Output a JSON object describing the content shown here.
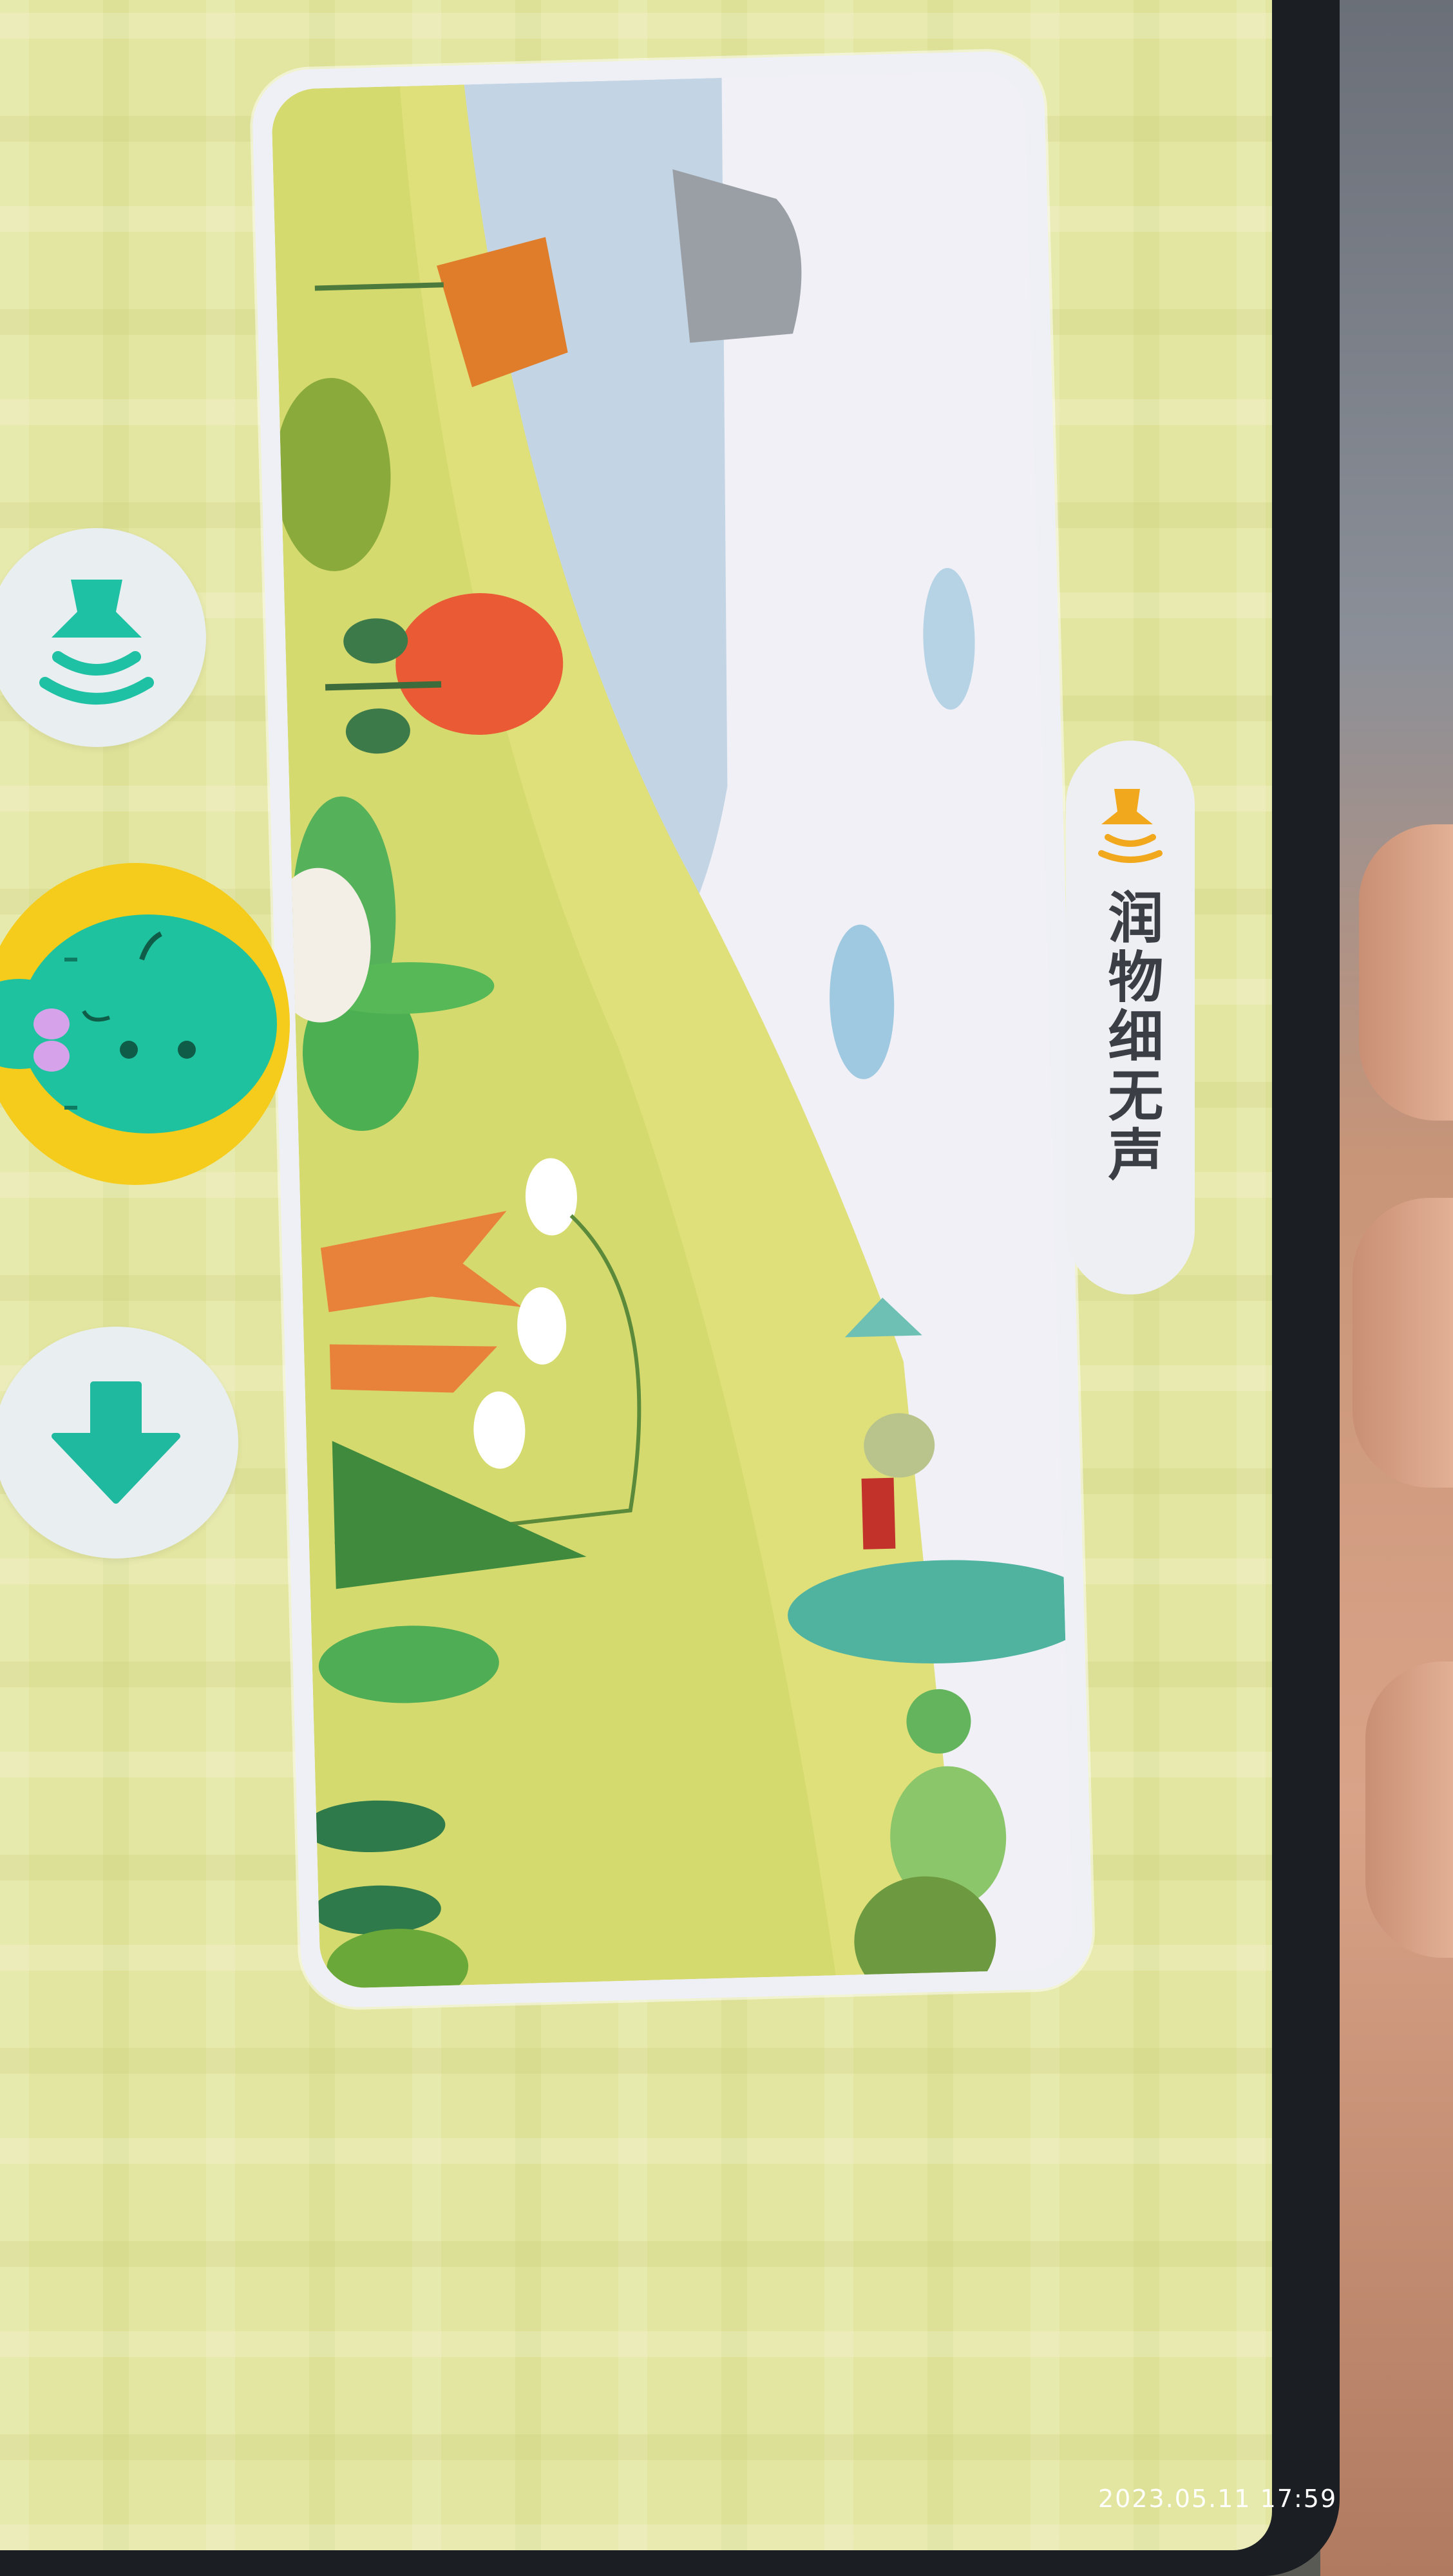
{
  "caption": {
    "text": "润物细无声",
    "icon": "speaker-icon"
  },
  "buttons": {
    "sound": {
      "icon": "speaker-wave-icon"
    },
    "mascot": {
      "icon": "dinosaur-mascot-icon"
    },
    "download": {
      "icon": "down-arrow-icon"
    }
  },
  "story": {
    "image": "spring-meadow-illustration"
  },
  "overlay": {
    "timestamp": "2023.05.11 17:59"
  },
  "colors": {
    "accent": "#1fc1a4",
    "mascot_bg": "#f5cc1c",
    "screen_bg": "#e3e6a0",
    "caption_icon": "#f2a81d"
  }
}
